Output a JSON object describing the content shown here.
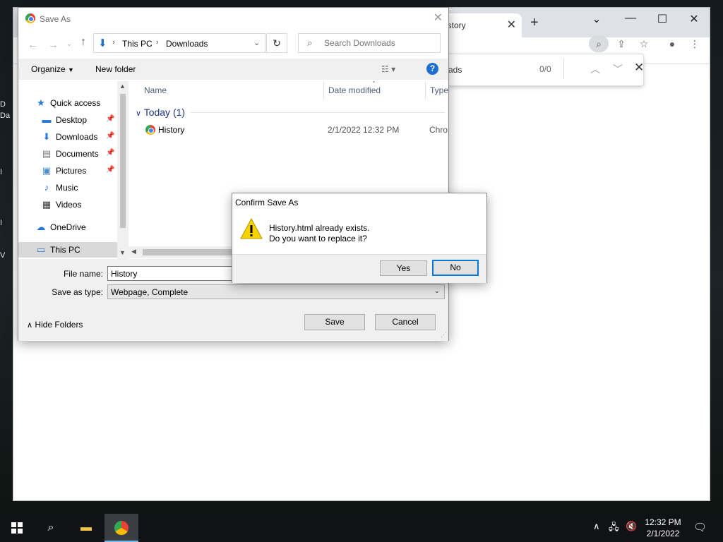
{
  "desktop": {
    "fragments": [
      {
        "text": "D"
      },
      {
        "text": "Da"
      },
      {
        "text": "I"
      },
      {
        "text": "I"
      },
      {
        "text": "V"
      }
    ]
  },
  "chrome": {
    "tab_title": "History",
    "tab_visible_text": "istory",
    "find": {
      "text_visible": "ads",
      "count": "0/0"
    }
  },
  "save_dialog": {
    "title": "Save As",
    "address": {
      "crumbs": [
        "This PC",
        "Downloads"
      ]
    },
    "search": {
      "placeholder": "Search Downloads"
    },
    "commands": {
      "organize": "Organize",
      "new_folder": "New folder"
    },
    "nav": {
      "quick_access": "Quick access",
      "items": [
        {
          "label": "Desktop",
          "icon": "desktop-icon",
          "pinned": true
        },
        {
          "label": "Downloads",
          "icon": "download-arrow-icon",
          "pinned": true
        },
        {
          "label": "Documents",
          "icon": "document-icon",
          "pinned": true
        },
        {
          "label": "Pictures",
          "icon": "picture-icon",
          "pinned": true
        },
        {
          "label": "Music",
          "icon": "music-note-icon",
          "pinned": false
        },
        {
          "label": "Videos",
          "icon": "film-icon",
          "pinned": false
        }
      ],
      "onedrive": "OneDrive",
      "this_pc": "This PC"
    },
    "columns": {
      "name": "Name",
      "date_modified": "Date modified",
      "type": "Type"
    },
    "group": {
      "label": "Today (1)"
    },
    "files": [
      {
        "name": "History",
        "date_modified": "2/1/2022 12:32 PM",
        "type": "Chro"
      }
    ],
    "file_name_label": "File name:",
    "file_name_value": "History",
    "save_type_label": "Save as type:",
    "save_type_value": "Webpage, Complete",
    "hide_folders": "Hide Folders",
    "save_button": "Save",
    "cancel_button": "Cancel"
  },
  "confirm_dialog": {
    "title": "Confirm Save As",
    "message_line1": "History.html already exists.",
    "message_line2": "Do you want to replace it?",
    "yes": "Yes",
    "no": "No",
    "icon": "warning-icon"
  },
  "taskbar": {
    "time": "12:32 PM",
    "date": "2/1/2022"
  },
  "colors": {
    "accent": "#0078d7",
    "group_header": "#1e3287",
    "warning": "#f6d200"
  }
}
